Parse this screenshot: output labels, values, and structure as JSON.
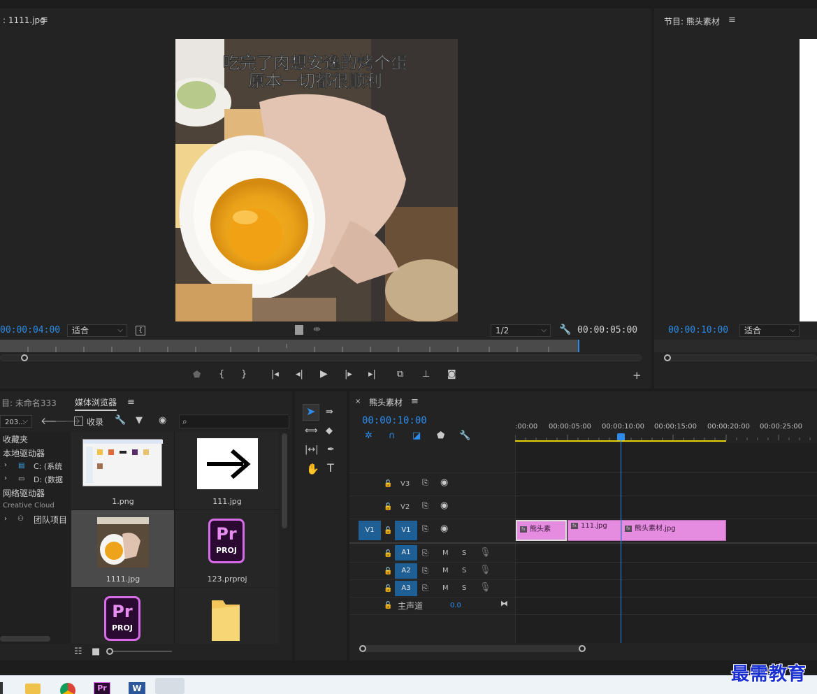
{
  "source_monitor": {
    "title": ": 1111.jpg",
    "overlay_line1": "吃完了肉想安逸的烤个蛋",
    "overlay_line2": "原本一切都很顺利",
    "timecode_in": "00:00:04:00",
    "fit_label": "适合",
    "resolution_label": "1/2",
    "timecode_duration": "00:00:05:00"
  },
  "program_monitor": {
    "title": "节目: 熊头素材",
    "timecode": "00:00:10:00",
    "fit_label": "适合"
  },
  "project_panel": {
    "tab_project": "目: 未命名333",
    "tab_media_browser": "媒体浏览器",
    "path_label": "203...",
    "ingest_label": "收录",
    "tree": {
      "favorites": "收藏夹",
      "local_drives": "本地驱动器",
      "drive_c": "C: (系统",
      "drive_d": "D: (数据",
      "network_drives": "网络驱动器",
      "creative_cloud": "Creative Cloud",
      "team_projects": "团队项目"
    },
    "files": [
      {
        "name": "1.png"
      },
      {
        "name": "111.jpg"
      },
      {
        "name": "1111.jpg"
      },
      {
        "name": "123.prproj"
      }
    ],
    "proj_icon_pr": "Pr",
    "proj_icon_proj": "PROJ"
  },
  "timeline": {
    "tab_title": "熊头素材",
    "timecode": "00:00:10:00",
    "ruler": [
      ":00:00",
      "00:00:05:00",
      "00:00:10:00",
      "00:00:15:00",
      "00:00:20:00",
      "00:00:25:00"
    ],
    "tracks_video": [
      "V3",
      "V2",
      "V1"
    ],
    "tracks_audio": [
      "A1",
      "A2",
      "A3"
    ],
    "source_v1": "V1",
    "mute_label": "M",
    "solo_label": "S",
    "master_label": "主声道",
    "master_value": "0.0",
    "clips": [
      {
        "name": "熊头素"
      },
      {
        "name": "111.jpg"
      },
      {
        "name": "熊头素材.jpg"
      }
    ],
    "fx_label": "fx"
  },
  "watermark": "最需教育",
  "colors": {
    "accent_blue": "#2d8ceb",
    "clip_pink": "#e58be0",
    "work_area_yellow": "#e8d000"
  }
}
